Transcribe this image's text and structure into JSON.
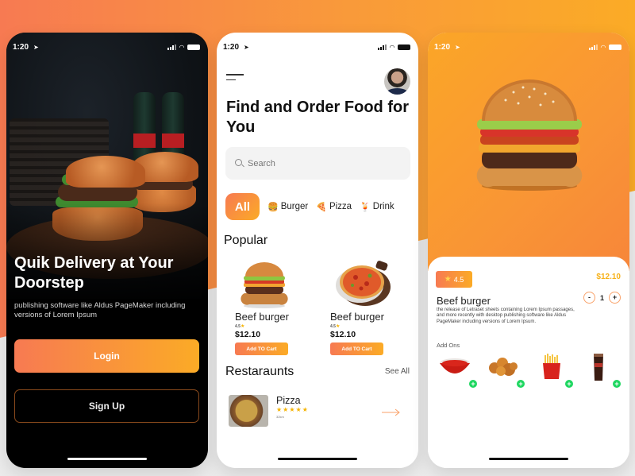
{
  "colors": {
    "brand_gradient_start": "#f77a52",
    "brand_gradient_end": "#fbab26",
    "price_accent": "#f7b21a",
    "star": "#f5b301",
    "add_on_plus": "#1ed760"
  },
  "status_bar": {
    "time": "1:20",
    "icons": [
      "location-arrow-icon",
      "signal-icon",
      "wifi-icon",
      "battery-icon"
    ]
  },
  "screen_welcome": {
    "title": "Quik Delivery at Your Doorstep",
    "subtitle": "publishing software like Aldus PageMaker including versions of Lorem Ipsum",
    "login_label": "Login",
    "signup_label": "Sign Up",
    "hero_image": "burgers-and-cola-photo"
  },
  "screen_home": {
    "title": "Find and Order Food for You",
    "search": {
      "placeholder": "Search",
      "value": ""
    },
    "categories": [
      {
        "label": "All",
        "icon": "",
        "active": true
      },
      {
        "label": "Burger",
        "icon": "🍔",
        "active": false
      },
      {
        "label": "Pizza",
        "icon": "🍕",
        "active": false
      },
      {
        "label": "Drink",
        "icon": "🍹",
        "active": false
      }
    ],
    "popular_heading": "Popular",
    "popular": [
      {
        "name": "Beef burger",
        "rating": "4.5",
        "price": "$12.10",
        "button": "Add TO Cart",
        "image": "burger"
      },
      {
        "name": "Beef burger",
        "rating": "4.5",
        "price": "$12.10",
        "button": "Add TO Cart",
        "image": "pizza"
      }
    ],
    "restaurants_heading": "Restaraunts",
    "see_all_label": "See All",
    "restaurants": [
      {
        "name": "Pizza",
        "stars": "★★★★★",
        "rating_value": 5,
        "distance": "32km"
      }
    ]
  },
  "screen_detail": {
    "rating": "4.5",
    "price": "$12.10",
    "name": "Beef burger",
    "description": "the release of Letraset sheets containing Lorem Ipsum passages, and more recently with desktop publishing software like Aldus PageMaker including versions of Lorem Ipsum.",
    "quantity": "1",
    "minus_label": "-",
    "plus_label": "+",
    "add_ons_label": "Add Ons",
    "add_ons": [
      {
        "name": "ketchup",
        "plus": "+"
      },
      {
        "name": "fried-chicken",
        "plus": "+"
      },
      {
        "name": "fries",
        "plus": "+"
      },
      {
        "name": "cola",
        "plus": "+"
      }
    ]
  }
}
